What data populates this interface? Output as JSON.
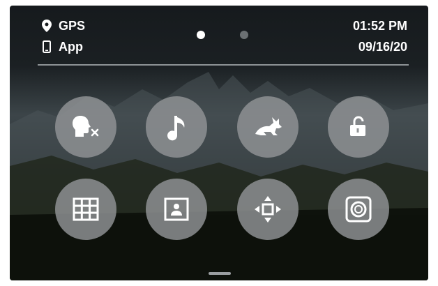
{
  "status": {
    "gps_label": "GPS",
    "app_label": "App",
    "time": "01:52 PM",
    "date": "09/16/20"
  },
  "pager": {
    "pages": 2,
    "current": 1
  },
  "controls": {
    "row1": [
      {
        "icon": "voice-control-off-icon"
      },
      {
        "icon": "beeps-music-note-icon"
      },
      {
        "icon": "quickcapture-rabbit-icon"
      },
      {
        "icon": "screen-lock-unlocked-icon"
      }
    ],
    "row2": [
      {
        "icon": "grid-icon"
      },
      {
        "icon": "portrait-orientation-icon"
      },
      {
        "icon": "orientation-move-icon"
      },
      {
        "icon": "lens-icon"
      }
    ]
  },
  "colors": {
    "button_fill": "#919496",
    "text": "#ffffff",
    "active_dot": "#ffffff",
    "inactive_dot": "#6b7073"
  }
}
